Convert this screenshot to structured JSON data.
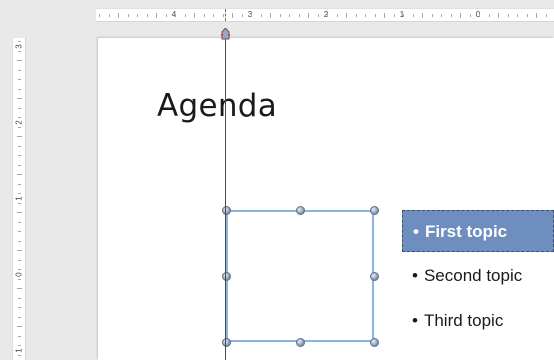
{
  "ruler": {
    "top_numbers": [
      "4",
      "3",
      "2",
      "1",
      "0"
    ],
    "left_numbers": [
      "3",
      "2",
      "1",
      "0",
      "1"
    ]
  },
  "slide": {
    "title": "Agenda",
    "topics": [
      {
        "label": "First topic",
        "selected": true
      },
      {
        "label": "Second topic",
        "selected": false
      },
      {
        "label": "Third topic",
        "selected": false
      }
    ],
    "bullet": "•"
  },
  "colors": {
    "guide": "#b000b0",
    "shape_outline": "#8db3e2",
    "selected_fill": "#6d8ebf"
  }
}
